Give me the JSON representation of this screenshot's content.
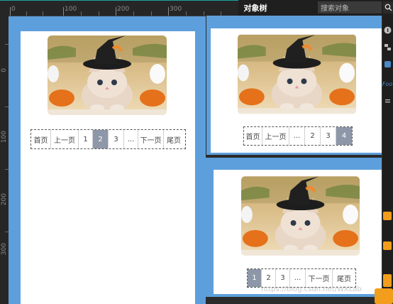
{
  "ruler": {
    "labels": [
      "0",
      "100",
      "200",
      "300"
    ],
    "left_labels": [
      "0",
      "100",
      "200",
      "300"
    ]
  },
  "panel": {
    "tab_label": "对象树",
    "search_placeholder": "搜索对象",
    "side_label": "Foo"
  },
  "pagers": {
    "p1": [
      "首页",
      "上一页",
      "1",
      "2",
      "3",
      "...",
      "下一页",
      "尾页"
    ],
    "p2": [
      "首页",
      "上一页",
      "...",
      "2",
      "3",
      "4"
    ],
    "p3": [
      "1",
      "2",
      "3",
      "...",
      "下一页",
      "尾页"
    ]
  },
  "watermark": "https://blog.csdn.net/WXLab",
  "colors": {
    "accent": "#18a6a3",
    "artboard": "#5d9fdc",
    "active_page": "#8d97a8",
    "warn": "#f29d1b"
  }
}
